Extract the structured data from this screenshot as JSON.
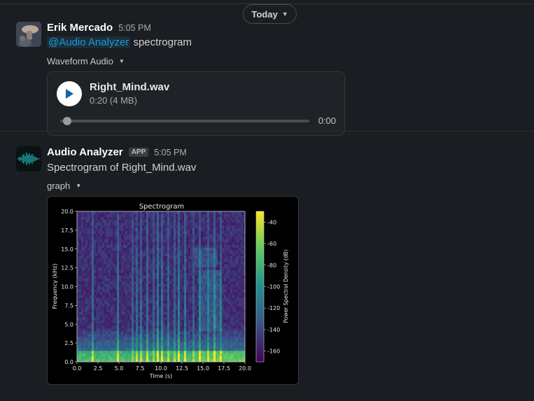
{
  "divider": {
    "label": "Today"
  },
  "messages": [
    {
      "sender": "Erik Mercado",
      "time": "5:05 PM",
      "mention": "@Audio Analyzer",
      "text": " spectrogram",
      "attachment_label": "Waveform Audio",
      "audio": {
        "file_name": "Right_Mind.wav",
        "meta": "0:20 (4 MB)",
        "elapsed": "0:00",
        "progress": 0.0
      }
    },
    {
      "sender": "Audio Analyzer",
      "badge": "APP",
      "time": "5:05 PM",
      "text": "Spectrogram of Right_Mind.wav",
      "attachment_label": "graph"
    }
  ],
  "colors": {
    "background": "#1a1d21",
    "mention": "#1d9bd1",
    "card_border": "#35373b"
  },
  "chart_data": {
    "type": "heatmap",
    "title": "Spectrogram",
    "xlabel": "Time (s)",
    "ylabel": "Frequency (kHz)",
    "colorbar_label": "Power Spectral Density (dB)",
    "xlim": [
      0,
      20
    ],
    "ylim": [
      0,
      20
    ],
    "clim": [
      -170,
      -30
    ],
    "xticks": [
      "0.0",
      "2.5",
      "5.0",
      "7.5",
      "10.0",
      "12.5",
      "15.0",
      "17.5",
      "20.0"
    ],
    "yticks": [
      "0.0",
      "2.5",
      "5.0",
      "7.5",
      "10.0",
      "12.5",
      "15.0",
      "17.5",
      "20.0"
    ],
    "cticks": [
      "-40",
      "-60",
      "-80",
      "-100",
      "-120",
      "-140",
      "-160"
    ],
    "colormap": "viridis"
  }
}
